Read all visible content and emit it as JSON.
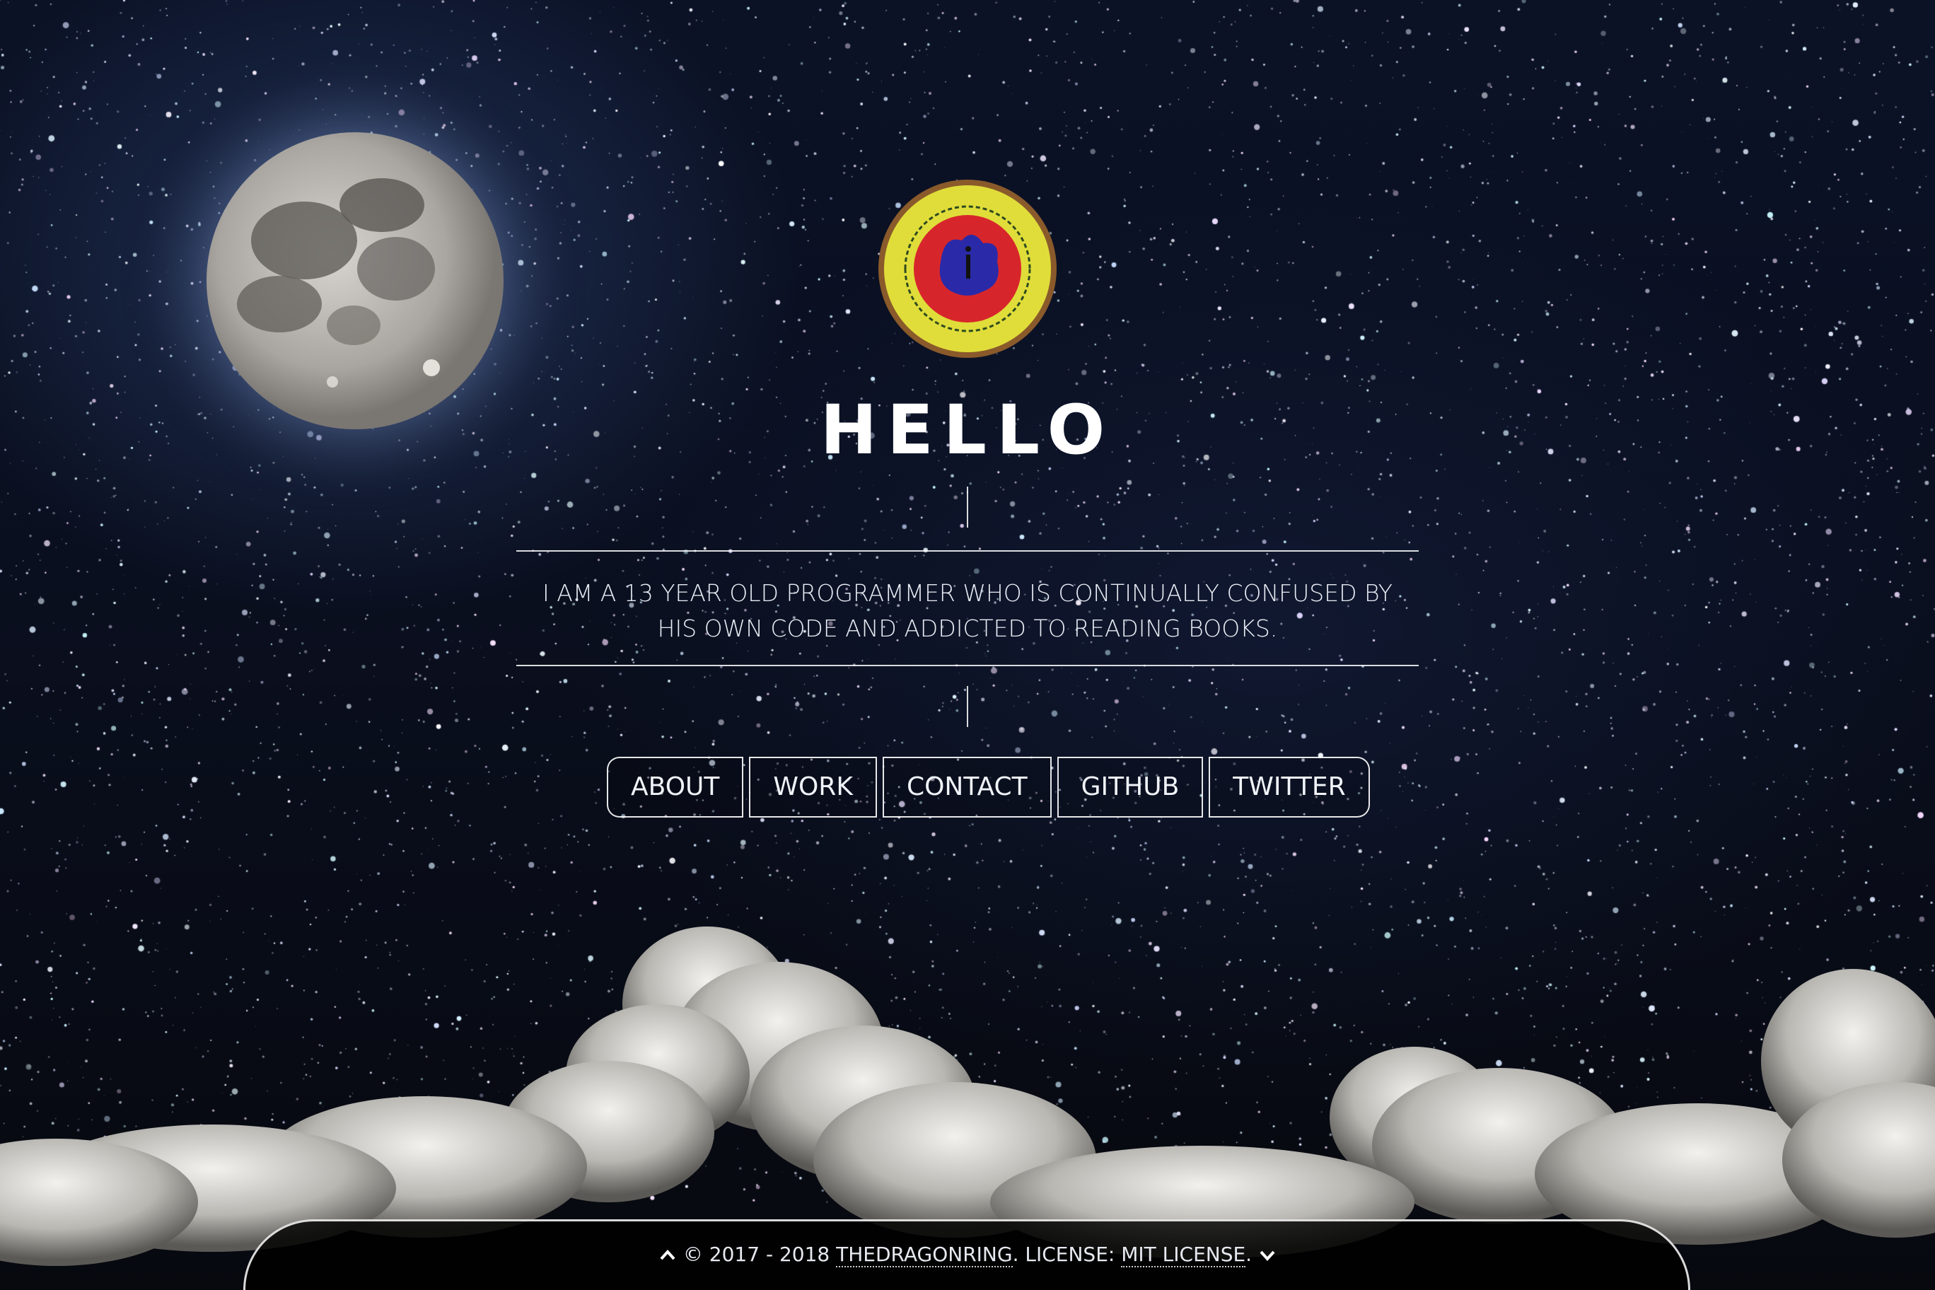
{
  "hero": {
    "title": "HELLO",
    "tagline_line1": "I AM A 13 YEAR OLD PROGRAMMER WHO IS CONTINUALLY CONFUSED BY",
    "tagline_line2": "HIS OWN CODE AND ADDICTED TO READING BOOKS."
  },
  "nav": {
    "items": [
      {
        "label": "ABOUT"
      },
      {
        "label": "WORK"
      },
      {
        "label": "CONTACT"
      },
      {
        "label": "GITHUB"
      },
      {
        "label": "TWITTER"
      }
    ]
  },
  "footer": {
    "copyright": "© 2017 - 2018",
    "author_link": "THEDRAGONRING",
    "license_prefix": ". LICENSE:",
    "license_link": "MIT LICENSE",
    "end_punct": "."
  },
  "icons": {
    "scroll_up": "chevron-up-icon",
    "scroll_down": "chevron-down-icon",
    "logo": "dragon-ring-logo"
  },
  "colors": {
    "background": "#0a0f1f",
    "text": "#ffffff",
    "logo_ring": "#e4e23a",
    "logo_center": "#d7262b",
    "logo_figure": "#2a2aa8"
  }
}
